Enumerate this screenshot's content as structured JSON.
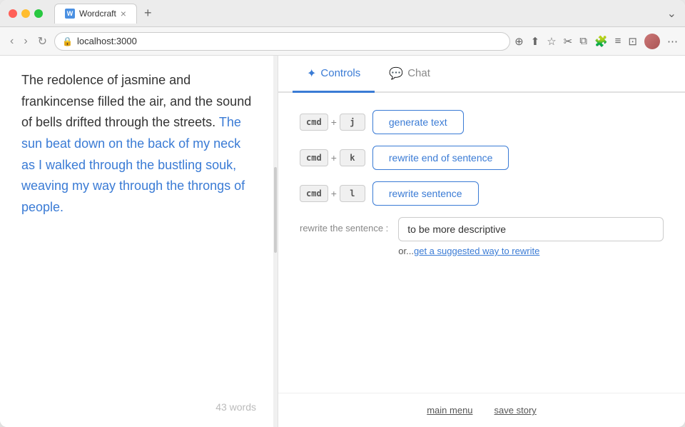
{
  "browser": {
    "tab_title": "Wordcraft",
    "url": "localhost:3000",
    "tab_close": "×",
    "tab_new": "+",
    "nav_back": "‹",
    "nav_forward": "›",
    "nav_refresh": "↻",
    "chevron": "⌄"
  },
  "editor": {
    "text_normal": "The redolence of jasmine and frankincense filled the air, and the sound of bells drifted through the streets.",
    "text_highlight": " The sun beat down on the back of my neck as I walked through the bustling souk, weaving my way through the throngs of people.",
    "word_count": "43 words"
  },
  "controls": {
    "tabs": [
      {
        "id": "controls",
        "label": "Controls",
        "active": true
      },
      {
        "id": "chat",
        "label": "Chat",
        "active": false
      }
    ],
    "commands": [
      {
        "shortcut_mod": "cmd",
        "shortcut_key": "j",
        "label": "generate text"
      },
      {
        "shortcut_mod": "cmd",
        "shortcut_key": "k",
        "label": "rewrite end of sentence"
      },
      {
        "shortcut_mod": "cmd",
        "shortcut_key": "l",
        "label": "rewrite sentence"
      }
    ],
    "rewrite_label": "rewrite the sentence :",
    "rewrite_placeholder": "to be more descriptive",
    "rewrite_input_value": "to be more descriptive",
    "suggest_prefix": "or...",
    "suggest_link_text": "get a suggested way to rewrite"
  },
  "footer": {
    "main_menu": "main menu",
    "save_story": "save story"
  },
  "icons": {
    "spark": "✦",
    "chat": "💬",
    "favicon": "W"
  }
}
